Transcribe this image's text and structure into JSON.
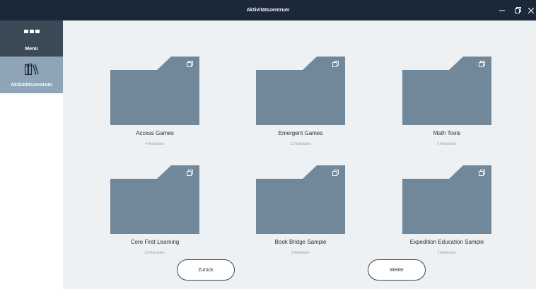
{
  "window": {
    "title": "Aktivitätszentrum",
    "controls": {
      "minimize": "–",
      "maximize": "❐",
      "close": "✕"
    }
  },
  "sidebar": {
    "items": [
      {
        "label": "Menü",
        "icon": "dots-menu-icon"
      },
      {
        "label": "Aktivitätszentrum",
        "icon": "books-icon",
        "active": true
      }
    ]
  },
  "tiles": [
    {
      "title": "Access Games",
      "count": "4 Aktivitäten"
    },
    {
      "title": "Emergent Games",
      "count": "13 Aktivitäten"
    },
    {
      "title": "Math Tools",
      "count": "6 Aktivitäten"
    },
    {
      "title": "Core First Learning",
      "count": "13 Aktivitäten"
    },
    {
      "title": "Book Bridge Sample",
      "count": "3 Aktivitäten"
    },
    {
      "title": "Expedition Education Sample",
      "count": "3 Aktivitäten"
    }
  ],
  "nav": {
    "back": "Zurück",
    "next": "Weiter"
  },
  "colors": {
    "titlebar": "#1b2839",
    "sidebar_menu": "#3c4a58",
    "sidebar_active": "#8fa4b6",
    "folder": "#71889b",
    "background": "#eef1f3"
  }
}
